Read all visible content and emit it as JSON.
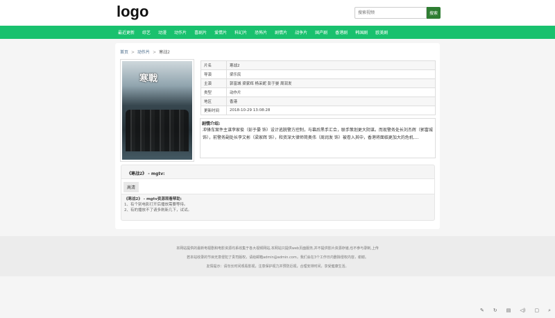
{
  "header": {
    "logo": "logo",
    "search_placeholder": "搜索视频",
    "search_button": "搜索"
  },
  "nav": [
    "最近更新",
    "综艺",
    "动漫",
    "动作片",
    "喜剧片",
    "爱情片",
    "科幻片",
    "恐怖片",
    "剧情片",
    "战争片",
    "国产剧",
    "香港剧",
    "韩国剧",
    "欧美剧"
  ],
  "breadcrumb": {
    "home": "首页",
    "category": "动作片",
    "current": "寒战2",
    "sep": ">"
  },
  "poster": {
    "title": "寒戰"
  },
  "info": [
    {
      "k": "片名",
      "v": "寒战2"
    },
    {
      "k": "导演",
      "v": "梁乐民"
    },
    {
      "k": "主演",
      "v": "郭富城 梁家辉 杨采妮 彭于晏 周润发"
    },
    {
      "k": "类型",
      "v": "动作片"
    },
    {
      "k": "地区",
      "v": "香港"
    },
    {
      "k": "更新时间",
      "v": "2018-10-29 13:08:28"
    }
  ],
  "plot": {
    "title": "剧情介绍:",
    "text": "冲锋车案件主谋李家俊（彭于晏 饰）设计逃脱警方控制，与幕后黑手汇合，联手策划更大阴谋。而现警务处长刘杰辉（郭富城 饰），前警务副处长李文彬（梁家辉 饰），和资深大律师简奥伟（周润发 饰）被卷入其中，香港将面临更加大的危机...."
  },
  "source": {
    "title": "《寒战2》 - mgtv:",
    "episodes": [
      "高清"
    ],
    "help_title": "《寒战2》 - mgtv资源观看帮助:",
    "help": [
      "1、有个别电影打开后播放需要等待。",
      "2、有的播放不了请多刷新几下，试试。"
    ]
  },
  "footer": [
    "本网站提供的最新电视剧和电影资源均系收集于各大视频网站,本网站只提供web页面服务,并不提供影片资源存储,也不参与录制,上传",
    "若本站收录的节目无意侵犯了贵司版权，请给邮箱admin@admin.com，我们会在3个工作日内删除侵权内容，谢谢。",
    "友情提示：请勿长时间观看影视，注意保护视力并预防近视，合理安排时间，享受健康生活。"
  ]
}
